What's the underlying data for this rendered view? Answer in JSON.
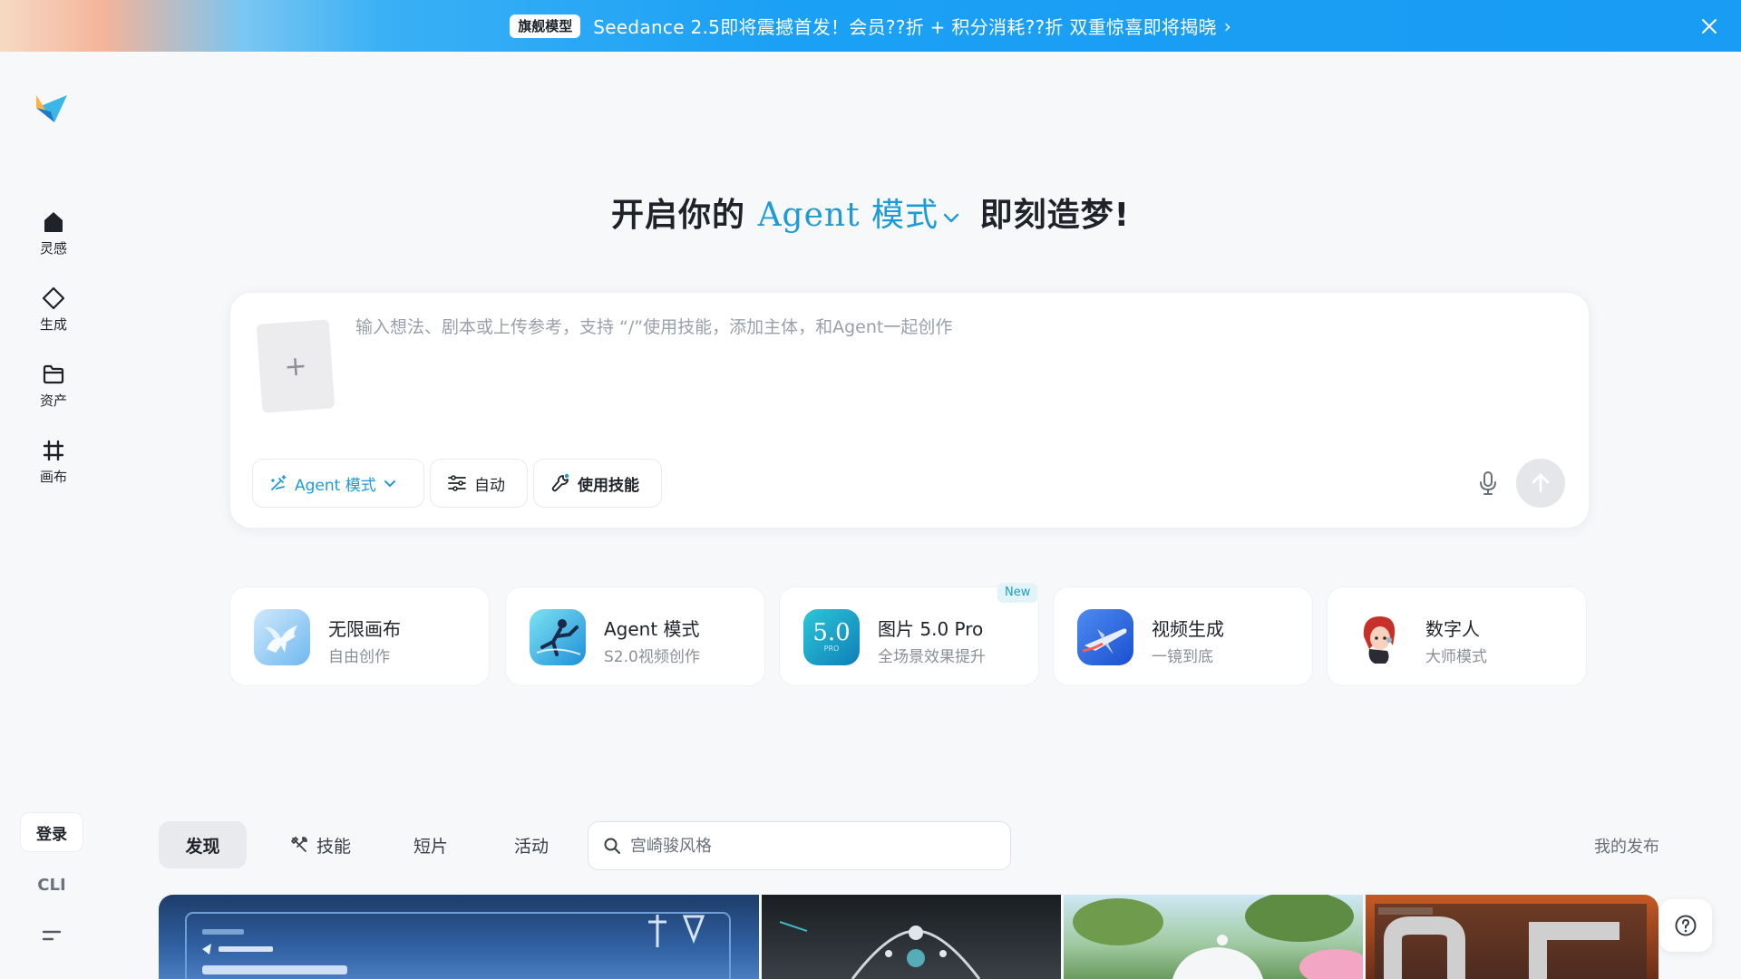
{
  "banner": {
    "tag": "旗舰模型",
    "text": "Seedance 2.5即将震撼首发！会员??折 + 积分消耗??折 双重惊喜即将揭晓",
    "arrow": "›"
  },
  "sidebar": {
    "logo_icon": "paper-plane-logo",
    "items": [
      {
        "label": "灵感",
        "icon": "home-icon"
      },
      {
        "label": "生成",
        "icon": "diamond-icon"
      },
      {
        "label": "资产",
        "icon": "folder-icon"
      },
      {
        "label": "画布",
        "icon": "frame-icon"
      }
    ],
    "login_label": "登录",
    "cli_label": "CLI",
    "menu_icon": "menu-icon"
  },
  "headline": {
    "prefix": "开启你的",
    "mode": "Agent 模式",
    "suffix": "即刻造梦!"
  },
  "composer": {
    "upload_symbol": "+",
    "placeholder": "输入想法、剧本或上传参考，支持 “/”使用技能，添加主体，和Agent一起创作",
    "value": "",
    "agent_label": "Agent 模式",
    "auto_label": "自动",
    "skill_label": "使用技能"
  },
  "features": [
    {
      "title": "无限画布",
      "sub": "自由创作"
    },
    {
      "title": "Agent 模式",
      "sub": "S2.0视频创作"
    },
    {
      "title": "图片 5.0 Pro",
      "sub": "全场景效果提升",
      "badge": "New",
      "icon_text": "5.0",
      "icon_subtext": "PRO"
    },
    {
      "title": "视频生成",
      "sub": "一镜到底"
    },
    {
      "title": "数字人",
      "sub": "大师模式"
    }
  ],
  "tabs": [
    {
      "label": "发现",
      "active": true
    },
    {
      "label": "技能",
      "active": false
    },
    {
      "label": "短片",
      "active": false
    },
    {
      "label": "活动",
      "active": false
    }
  ],
  "search": {
    "placeholder": "宫崎骏风格",
    "value": ""
  },
  "my_publish": "我的发布",
  "colors": {
    "accent": "#1d9bd7",
    "banner": "#189cf4"
  }
}
